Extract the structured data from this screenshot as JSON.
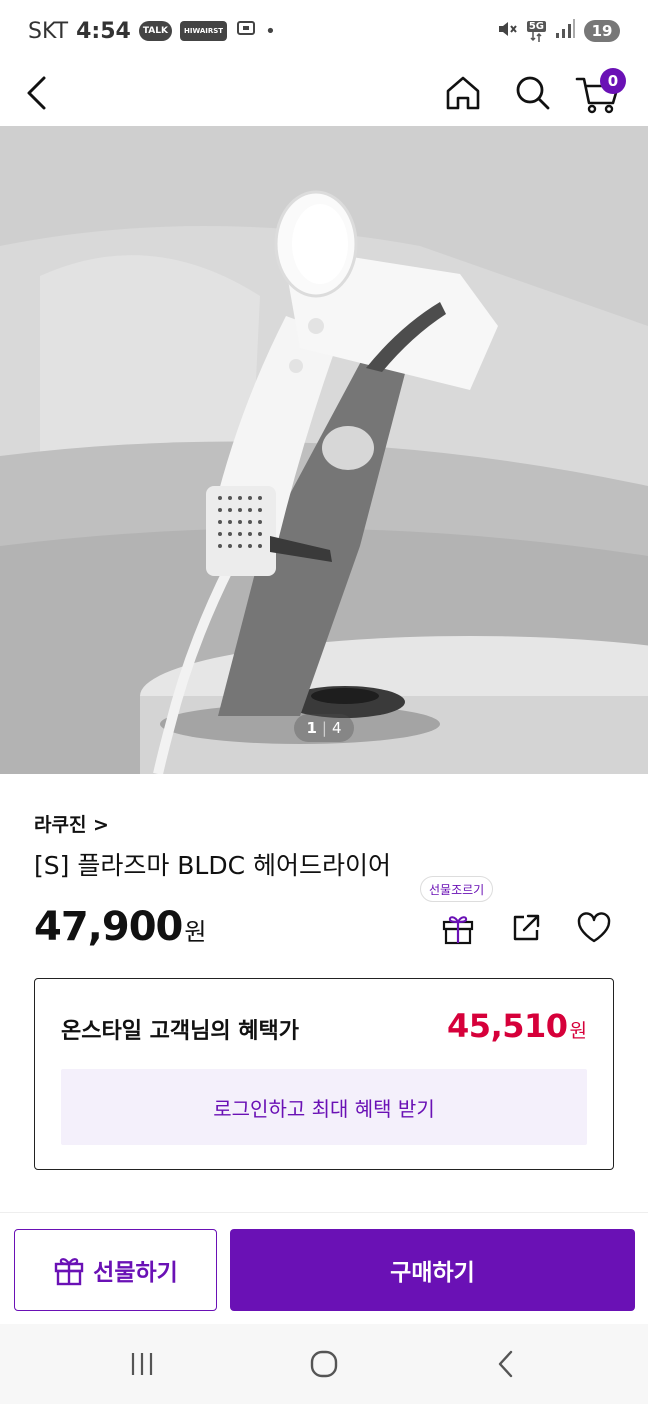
{
  "status_bar": {
    "carrier": "SKT",
    "time": "4:54",
    "badge_talk": "TALK",
    "badge_app": "HIWAIRST",
    "network": "5G",
    "battery": "19"
  },
  "nav": {
    "cart_count": "0"
  },
  "gallery": {
    "current": "1",
    "separator": "|",
    "total": "4"
  },
  "product": {
    "brand": "라쿠진 >",
    "title": "[S] 플라즈마 BLDC 헤어드라이어",
    "price": "47,900",
    "currency": "원",
    "gift_tooltip": "선물조르기"
  },
  "benefit": {
    "label": "온스타일 고객님의 혜택가",
    "price": "45,510",
    "currency": "원",
    "login_cta": "로그인하고 최대 혜택 받기"
  },
  "actions": {
    "gift_label": "선물하기",
    "buy_label": "구매하기"
  },
  "colors": {
    "brand_purple": "#6a11b5",
    "benefit_red": "#d6003a",
    "login_bg": "#f4f0fb"
  },
  "icons": [
    "back-arrow-icon",
    "home-icon",
    "search-icon",
    "cart-icon",
    "gift-icon",
    "share-icon",
    "heart-icon",
    "recents-icon",
    "home-circle-icon",
    "system-back-icon"
  ]
}
